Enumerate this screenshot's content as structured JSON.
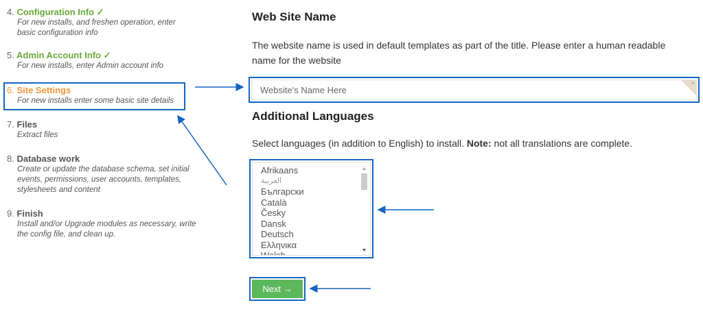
{
  "steps": [
    {
      "num": "4.",
      "title": "Configuration Info ✓",
      "desc": "For new installs, and freshen operation, enter basic configuration info",
      "state": "done"
    },
    {
      "num": "5.",
      "title": "Admin Account Info ✓",
      "desc": "For new installs, enter Admin account info",
      "state": "done"
    },
    {
      "num": "6.",
      "title": "Site Settings",
      "desc": "For new installs enter some basic site details",
      "state": "current"
    },
    {
      "num": "7.",
      "title": "Files",
      "desc": "Extract files",
      "state": "todo"
    },
    {
      "num": "8.",
      "title": "Database work",
      "desc": "Create or update the database schema, set initial events, permissions, user accounts, templates, stylesheets and content",
      "state": "todo"
    },
    {
      "num": "9.",
      "title": "Finish",
      "desc": "Install and/or Upgrade modules as necessary, write the config file, and clean up.",
      "state": "todo"
    }
  ],
  "site_name": {
    "heading": "Web Site Name",
    "description": "The website name is used in default templates as part of the title. Please enter a human readable name for the website",
    "placeholder": "Website's Name Here",
    "value": "",
    "required_marker": "*"
  },
  "languages": {
    "heading": "Additional Languages",
    "description_pre": "Select languages (in addition to English) to install. ",
    "note_label": "Note:",
    "description_post": " not all translations are complete.",
    "options": [
      "Afrikaans",
      "العربية",
      "Български",
      "Català",
      "Česky",
      "Dansk",
      "Deutsch",
      "Ελληνικα",
      "Welsh"
    ]
  },
  "next_button": "Next →",
  "colors": {
    "done": "#6aaa3a",
    "current": "#f0963a",
    "annotation": "#1565c0",
    "button": "#5cb85c"
  }
}
